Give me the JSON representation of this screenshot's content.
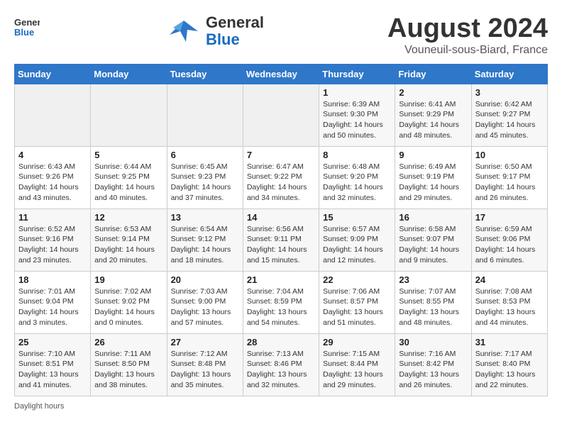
{
  "header": {
    "logo_general": "General",
    "logo_blue": "Blue",
    "month_title": "August 2024",
    "subtitle": "Vouneuil-sous-Biard, France"
  },
  "weekdays": [
    "Sunday",
    "Monday",
    "Tuesday",
    "Wednesday",
    "Thursday",
    "Friday",
    "Saturday"
  ],
  "weeks": [
    [
      {
        "day": "",
        "info": ""
      },
      {
        "day": "",
        "info": ""
      },
      {
        "day": "",
        "info": ""
      },
      {
        "day": "",
        "info": ""
      },
      {
        "day": "1",
        "info": "Sunrise: 6:39 AM\nSunset: 9:30 PM\nDaylight: 14 hours and 50 minutes."
      },
      {
        "day": "2",
        "info": "Sunrise: 6:41 AM\nSunset: 9:29 PM\nDaylight: 14 hours and 48 minutes."
      },
      {
        "day": "3",
        "info": "Sunrise: 6:42 AM\nSunset: 9:27 PM\nDaylight: 14 hours and 45 minutes."
      }
    ],
    [
      {
        "day": "4",
        "info": "Sunrise: 6:43 AM\nSunset: 9:26 PM\nDaylight: 14 hours and 43 minutes."
      },
      {
        "day": "5",
        "info": "Sunrise: 6:44 AM\nSunset: 9:25 PM\nDaylight: 14 hours and 40 minutes."
      },
      {
        "day": "6",
        "info": "Sunrise: 6:45 AM\nSunset: 9:23 PM\nDaylight: 14 hours and 37 minutes."
      },
      {
        "day": "7",
        "info": "Sunrise: 6:47 AM\nSunset: 9:22 PM\nDaylight: 14 hours and 34 minutes."
      },
      {
        "day": "8",
        "info": "Sunrise: 6:48 AM\nSunset: 9:20 PM\nDaylight: 14 hours and 32 minutes."
      },
      {
        "day": "9",
        "info": "Sunrise: 6:49 AM\nSunset: 9:19 PM\nDaylight: 14 hours and 29 minutes."
      },
      {
        "day": "10",
        "info": "Sunrise: 6:50 AM\nSunset: 9:17 PM\nDaylight: 14 hours and 26 minutes."
      }
    ],
    [
      {
        "day": "11",
        "info": "Sunrise: 6:52 AM\nSunset: 9:16 PM\nDaylight: 14 hours and 23 minutes."
      },
      {
        "day": "12",
        "info": "Sunrise: 6:53 AM\nSunset: 9:14 PM\nDaylight: 14 hours and 20 minutes."
      },
      {
        "day": "13",
        "info": "Sunrise: 6:54 AM\nSunset: 9:12 PM\nDaylight: 14 hours and 18 minutes."
      },
      {
        "day": "14",
        "info": "Sunrise: 6:56 AM\nSunset: 9:11 PM\nDaylight: 14 hours and 15 minutes."
      },
      {
        "day": "15",
        "info": "Sunrise: 6:57 AM\nSunset: 9:09 PM\nDaylight: 14 hours and 12 minutes."
      },
      {
        "day": "16",
        "info": "Sunrise: 6:58 AM\nSunset: 9:07 PM\nDaylight: 14 hours and 9 minutes."
      },
      {
        "day": "17",
        "info": "Sunrise: 6:59 AM\nSunset: 9:06 PM\nDaylight: 14 hours and 6 minutes."
      }
    ],
    [
      {
        "day": "18",
        "info": "Sunrise: 7:01 AM\nSunset: 9:04 PM\nDaylight: 14 hours and 3 minutes."
      },
      {
        "day": "19",
        "info": "Sunrise: 7:02 AM\nSunset: 9:02 PM\nDaylight: 14 hours and 0 minutes."
      },
      {
        "day": "20",
        "info": "Sunrise: 7:03 AM\nSunset: 9:00 PM\nDaylight: 13 hours and 57 minutes."
      },
      {
        "day": "21",
        "info": "Sunrise: 7:04 AM\nSunset: 8:59 PM\nDaylight: 13 hours and 54 minutes."
      },
      {
        "day": "22",
        "info": "Sunrise: 7:06 AM\nSunset: 8:57 PM\nDaylight: 13 hours and 51 minutes."
      },
      {
        "day": "23",
        "info": "Sunrise: 7:07 AM\nSunset: 8:55 PM\nDaylight: 13 hours and 48 minutes."
      },
      {
        "day": "24",
        "info": "Sunrise: 7:08 AM\nSunset: 8:53 PM\nDaylight: 13 hours and 44 minutes."
      }
    ],
    [
      {
        "day": "25",
        "info": "Sunrise: 7:10 AM\nSunset: 8:51 PM\nDaylight: 13 hours and 41 minutes."
      },
      {
        "day": "26",
        "info": "Sunrise: 7:11 AM\nSunset: 8:50 PM\nDaylight: 13 hours and 38 minutes."
      },
      {
        "day": "27",
        "info": "Sunrise: 7:12 AM\nSunset: 8:48 PM\nDaylight: 13 hours and 35 minutes."
      },
      {
        "day": "28",
        "info": "Sunrise: 7:13 AM\nSunset: 8:46 PM\nDaylight: 13 hours and 32 minutes."
      },
      {
        "day": "29",
        "info": "Sunrise: 7:15 AM\nSunset: 8:44 PM\nDaylight: 13 hours and 29 minutes."
      },
      {
        "day": "30",
        "info": "Sunrise: 7:16 AM\nSunset: 8:42 PM\nDaylight: 13 hours and 26 minutes."
      },
      {
        "day": "31",
        "info": "Sunrise: 7:17 AM\nSunset: 8:40 PM\nDaylight: 13 hours and 22 minutes."
      }
    ]
  ],
  "footer": "Daylight hours"
}
